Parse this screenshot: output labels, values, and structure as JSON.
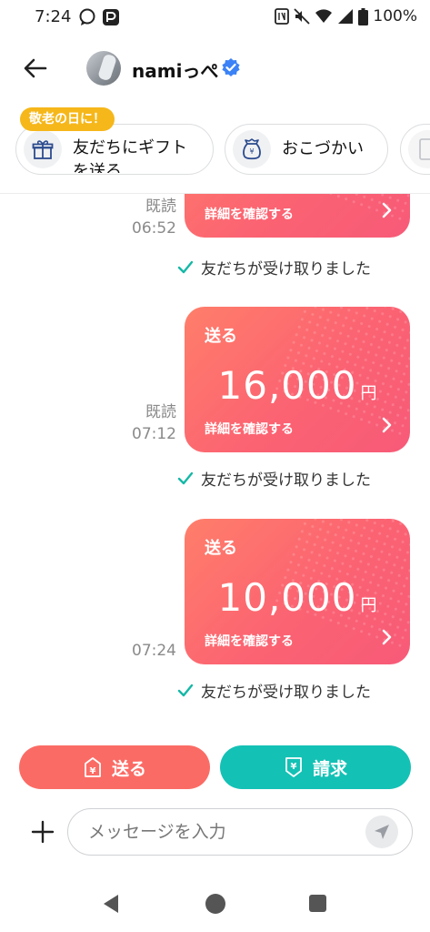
{
  "status_bar": {
    "time": "7:24",
    "battery": "100%",
    "icons": [
      "chat-bubble-icon",
      "paypay-icon",
      "nfc-icon",
      "mute-icon",
      "wifi-icon",
      "signal-icon",
      "battery-icon"
    ]
  },
  "header": {
    "user_name": "namiっぺ",
    "verified": true
  },
  "quick_actions": {
    "badge": "敬老の日に！",
    "items": [
      {
        "label": "友だちにギフトを送る",
        "icon": "gift-icon"
      },
      {
        "label": "おこづかい",
        "icon": "money-pouch-icon"
      }
    ]
  },
  "messages": [
    {
      "read": "既読",
      "time": "06:52",
      "kind": "",
      "amount": "",
      "unit": "",
      "detail": "詳細を確認する",
      "status": "友だちが受け取りました"
    },
    {
      "read": "既読",
      "time": "07:12",
      "kind": "送る",
      "amount": "16,000",
      "unit": "円",
      "detail": "詳細を確認する",
      "status": "友だちが受け取りました"
    },
    {
      "read": "",
      "time": "07:24",
      "kind": "送る",
      "amount": "10,000",
      "unit": "円",
      "detail": "詳細を確認する",
      "status": "友だちが受け取りました"
    }
  ],
  "actions": {
    "send_label": "送る",
    "request_label": "請求"
  },
  "input": {
    "placeholder": "メッセージを入力",
    "value": ""
  },
  "colors": {
    "card": "#fb6372",
    "send_button": "#fb6b65",
    "request_button": "#14c1b5",
    "badge": "#f6b71a",
    "check": "#14b8a6"
  }
}
